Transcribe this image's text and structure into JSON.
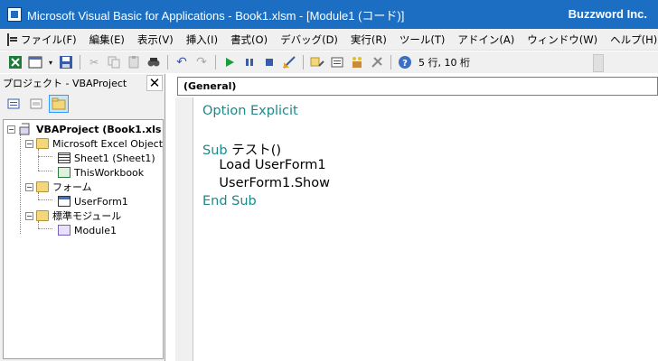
{
  "window": {
    "title": "Microsoft Visual Basic for Applications - Book1.xlsm - [Module1 (コード)]",
    "brand": "Buzzword Inc."
  },
  "menu": [
    {
      "label": "ファイル(F)"
    },
    {
      "label": "編集(E)"
    },
    {
      "label": "表示(V)"
    },
    {
      "label": "挿入(I)"
    },
    {
      "label": "書式(O)"
    },
    {
      "label": "デバッグ(D)"
    },
    {
      "label": "実行(R)"
    },
    {
      "label": "ツール(T)"
    },
    {
      "label": "アドイン(A)"
    },
    {
      "label": "ウィンドウ(W)"
    },
    {
      "label": "ヘルプ(H)"
    }
  ],
  "toolbar": {
    "position": "5 行, 10 桁"
  },
  "project_panel": {
    "title": "プロジェクト - VBAProject",
    "tree": [
      {
        "label": "VBAProject (Book1.xls"
      },
      {
        "label": "Microsoft Excel Object"
      },
      {
        "label": "Sheet1 (Sheet1)"
      },
      {
        "label": "ThisWorkbook"
      },
      {
        "label": "フォーム"
      },
      {
        "label": "UserForm1"
      },
      {
        "label": "標準モジュール"
      },
      {
        "label": "Module1"
      }
    ]
  },
  "editor": {
    "object_dropdown": "(General)",
    "code": {
      "line1_kw": "Option Explicit",
      "line3_kw": "Sub",
      "line3_rest": " テスト()",
      "line4": "    Load UserForm1",
      "line5": "    UserForm1.Show",
      "line6_kw": "End Sub"
    }
  }
}
